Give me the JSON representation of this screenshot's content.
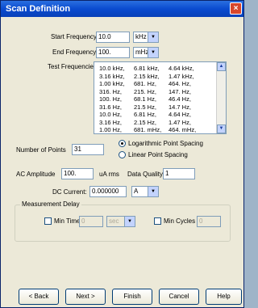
{
  "window": {
    "title": "Scan Definition",
    "close_glyph": "×"
  },
  "start_frequency": {
    "label": "Start Frequency",
    "value": "10.0",
    "unit": "kHz"
  },
  "end_frequency": {
    "label": "End Frequency",
    "value": "100.",
    "unit": "mHz"
  },
  "test_frequencies": {
    "label": "Test Frequencies",
    "rows": [
      [
        "10.0 kHz,",
        "6.81 kHz,",
        "4.64 kHz,"
      ],
      [
        "3.16 kHz,",
        "2.15 kHz,",
        "1.47 kHz,"
      ],
      [
        "1.00 kHz,",
        "681.  Hz,",
        "464.  Hz,"
      ],
      [
        "316.  Hz,",
        "215.  Hz,",
        "147.  Hz,"
      ],
      [
        "100.  Hz,",
        "68.1  Hz,",
        "46.4  Hz,"
      ],
      [
        "31.6  Hz,",
        "21.5  Hz,",
        "14.7  Hz,"
      ],
      [
        "10.0  Hz,",
        "6.81  Hz,",
        "4.64  Hz,"
      ],
      [
        "3.16  Hz,",
        "2.15  Hz,",
        "1.47  Hz,"
      ],
      [
        "1.00  Hz,",
        "681.  mHz,",
        "464.  mHz,"
      ]
    ]
  },
  "number_of_points": {
    "label": "Number of Points",
    "value": "31"
  },
  "spacing": {
    "log_label": "Logarithmic Point Spacing",
    "linear_label": "Linear Point Spacing",
    "selected": "log"
  },
  "ac_amplitude": {
    "label": "AC Amplitude",
    "value": "100.",
    "unit": "uA rms"
  },
  "data_quality": {
    "label": "Data Quality",
    "value": "1"
  },
  "dc_current": {
    "label": "DC Current:",
    "value": "0.000000",
    "unit": "A"
  },
  "measurement_delay": {
    "title": "Measurement Delay",
    "min_time_label": "Min Time",
    "min_time_value": "0",
    "min_time_unit": "sec",
    "min_cycles_label": "Min Cycles",
    "min_cycles_value": "0"
  },
  "buttons": {
    "back": "< Back",
    "next": "Next >",
    "finish": "Finish",
    "cancel": "Cancel",
    "help": "Help"
  }
}
